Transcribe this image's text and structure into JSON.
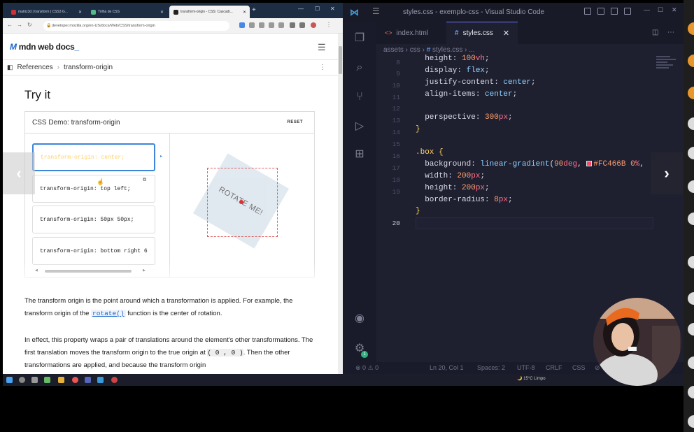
{
  "browser": {
    "tabs": [
      {
        "title": "matriz3d | transform | CSS3 G..."
      },
      {
        "title": "Trilha de CSS"
      },
      {
        "title": "transform-origin - CSS: Cascadi..."
      }
    ],
    "url": "developer.mozilla.org/en-US/docs/Web/CSS/transform-origin",
    "site_name": "mdn web docs",
    "breadcrumb": [
      "References",
      "transform-origin"
    ],
    "heading": "Try it",
    "demo": {
      "title": "CSS Demo: transform-origin",
      "reset_label": "RESET",
      "options": [
        "transform-origin: center;",
        "transform-origin: top left;",
        "transform-origin: 50px 50px;",
        "transform-origin: bottom right 6"
      ],
      "box_text": "ROTATE ME!"
    },
    "paragraph1_a": "The transform origin is the point around which a transformation is applied. For example, the transform origin of the ",
    "paragraph1_code": "rotate()",
    "paragraph1_b": " function is the center of rotation.",
    "paragraph2_a": "In effect, this property wraps a pair of translations around the element's other transformations. The first translation moves the transform origin to the true origin at ",
    "paragraph2_code": "( 0 , 0 )",
    "paragraph2_b": ". Then the other transformations are applied, and because the transform origin"
  },
  "vscode": {
    "title": "styles.css - exemplo-css - Visual Studio Code",
    "tabs": [
      {
        "label": "index.html"
      },
      {
        "label": "styles.css"
      }
    ],
    "breadcrumb": [
      "assets",
      "css",
      "styles.css",
      "..."
    ],
    "line_numbers": [
      "8",
      "9",
      "10",
      "11",
      "12",
      "13",
      "14",
      "15",
      "16",
      "17",
      "18",
      "19",
      "20"
    ],
    "status": {
      "errors": "0",
      "warnings": "0",
      "position": "Ln 20, Col 1",
      "spaces": "Spaces: 2",
      "encoding": "UTF-8",
      "eol": "CRLF",
      "language": "CSS",
      "settings_badge": "1"
    }
  },
  "taskbar": {
    "weather": "15°C Limpo"
  },
  "colors": {
    "vscode_bg": "#1e2030",
    "accent_pink": "#FC466B",
    "mdn_blue": "#1a66c9",
    "notification_orange": "#e8962e"
  }
}
